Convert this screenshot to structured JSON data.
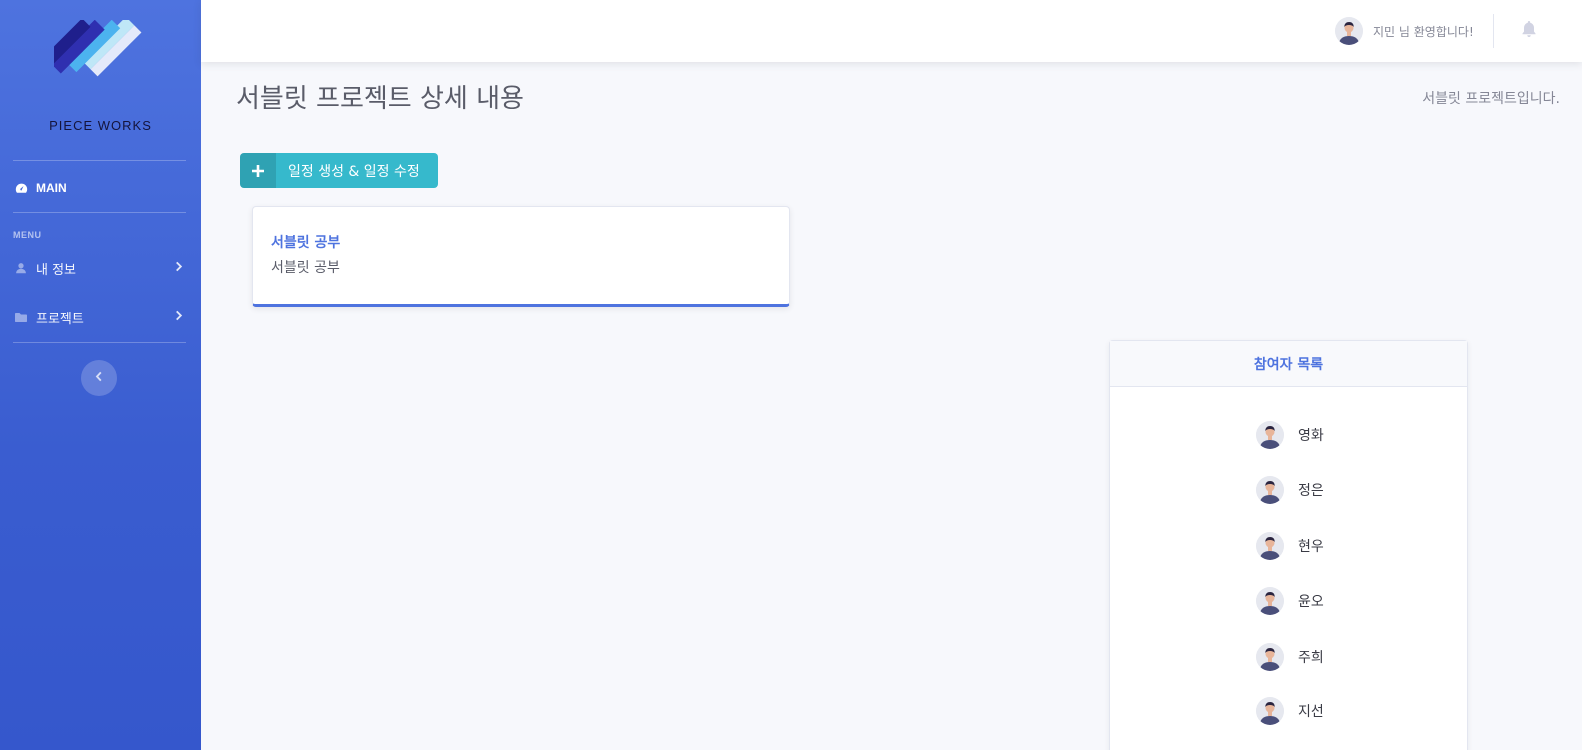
{
  "sidebar": {
    "brand": "PIECE WORKS",
    "main_label": "MAIN",
    "menu_heading": "MENU",
    "items": [
      {
        "label": "내 정보",
        "icon": "user-icon"
      },
      {
        "label": "프로젝트",
        "icon": "folder-icon"
      }
    ],
    "toggle_icon": "chevron-left-icon"
  },
  "topbar": {
    "welcome": "지민 님 환영합니다!",
    "bell_icon": "bell-icon"
  },
  "page": {
    "title": "서블릿 프로젝트 상세 내용",
    "description": "서블릿 프로젝트입니다."
  },
  "actions": {
    "add_schedule_label": "일정 생성 & 일정 수정",
    "add_icon": "plus-icon"
  },
  "task": {
    "title": "서블릿 공부",
    "description": "서블릿 공부"
  },
  "participants": {
    "header": "참여자 목록",
    "members": [
      "영화",
      "정은",
      "현우",
      "윤오",
      "주희",
      "지선"
    ]
  },
  "colors": {
    "primary": "#4e73df",
    "info": "#36b9cc",
    "text_gray": "#5a5c69",
    "muted": "#858796"
  }
}
